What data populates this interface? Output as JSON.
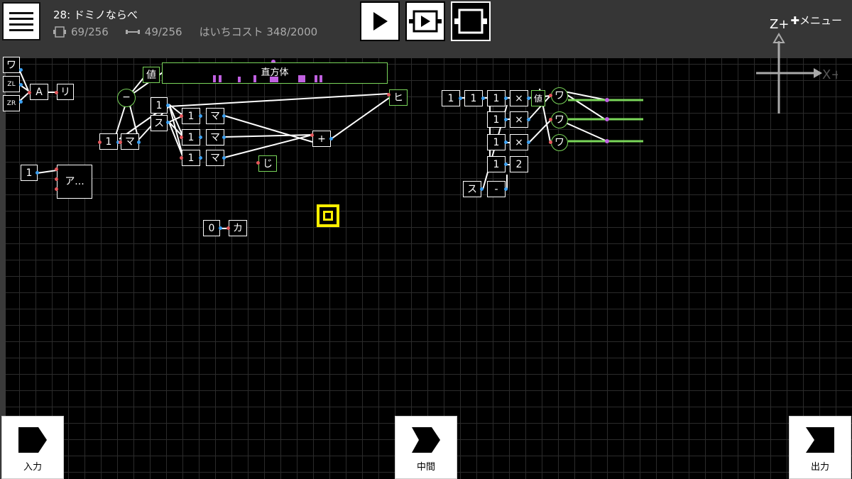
{
  "header": {
    "title": "28: ドミノならべ",
    "stats": [
      {
        "icon": "node-count-icon",
        "text": "69/256"
      },
      {
        "icon": "wire-count-icon",
        "text": "49/256"
      },
      {
        "icon": "",
        "text": "はいちコスト 348/2000"
      }
    ],
    "menu_label": "メニュー"
  },
  "toolbar": {
    "menu_icon": "hamburger-icon",
    "run_icon": "play-icon",
    "step_icon": "step-play-icon",
    "frame_icon": "frame-icon"
  },
  "axis": {
    "z": "Z+",
    "x": "X+"
  },
  "nodes": {
    "n_wa": "ワ",
    "n_zl": "ZL",
    "n_zr": "ZR",
    "n_a": "A",
    "n_ri": "リ",
    "n_atai": "値",
    "n_cube": "直方体",
    "n_minus_circle": "−",
    "n_1a": "1",
    "n_su": "ス",
    "n_1b": "1",
    "n_ma1": "マ",
    "n_1c": "1",
    "n_ma2": "マ",
    "n_1d": "1",
    "n_ma3": "マ",
    "n_1e": "1",
    "n_ma4": "マ",
    "n_plus": "+",
    "n_ji": "じ",
    "n_hi": "ヒ",
    "n_1f": "1",
    "n_a_ellipsis": "ア...",
    "n_0": "0",
    "n_ka": "カ",
    "n_r1": "1",
    "n_r2": "1",
    "n_r3": "1",
    "n_r4": "1",
    "n_r5": "1",
    "n_r6": "1",
    "n_x1": "×",
    "n_x2": "×",
    "n_x3": "×",
    "n_2": "2",
    "n_su2": "ス",
    "n_dash": "-",
    "n_atai2": "値",
    "n_wa1": "ワ",
    "n_wa2": "ワ",
    "n_wa3": "ワ"
  },
  "bottom": {
    "input_label": "入力",
    "middle_label": "中間",
    "output_label": "出力"
  },
  "colors": {
    "background": "#000000",
    "topbar": "#363636",
    "grid": "#2b2b2b",
    "wire": "#ffffff",
    "green_node": "#7ad65a",
    "marker": "#ffef00",
    "port_in": "#e4565a",
    "port_out": "#3ca0f0"
  }
}
